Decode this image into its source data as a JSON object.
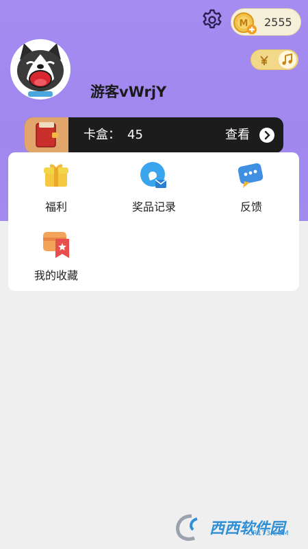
{
  "header": {
    "coins": "2555",
    "nickname": "游客vWrjY",
    "colors": {
      "header_bg": "#a48cf1",
      "coin_pill": "#f6efd9"
    }
  },
  "cardbox": {
    "label": "卡盒：",
    "count": "45",
    "view": "查看"
  },
  "menu": {
    "items": [
      {
        "label": "福利",
        "icon": "gift-icon"
      },
      {
        "label": "奖品记录",
        "icon": "prize-record-icon"
      },
      {
        "label": "反馈",
        "icon": "feedback-icon"
      },
      {
        "label": "我的收藏",
        "icon": "favorites-icon"
      }
    ]
  },
  "watermark": {
    "brand": "西西软件园",
    "site": "CR173.COM"
  }
}
